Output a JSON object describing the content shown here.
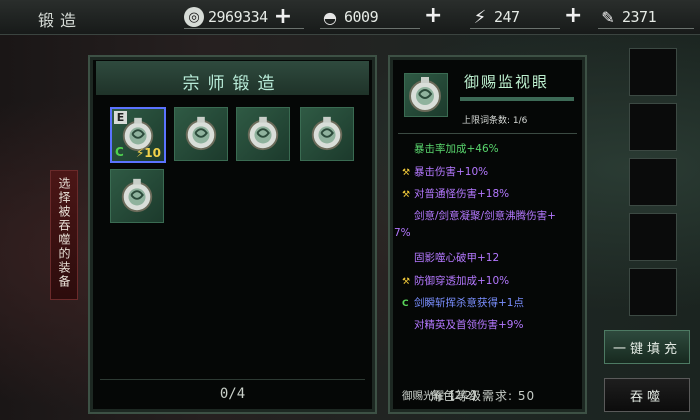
{
  "header": {
    "title": "锻造",
    "resources": [
      {
        "icon": "coin-icon",
        "value": "2969334"
      },
      {
        "icon": "silver-ingot-icon",
        "value": "6009"
      },
      {
        "icon": "lightning-icon",
        "value": "247"
      },
      {
        "icon": "ticket-icon",
        "value": "2371"
      }
    ]
  },
  "forge_panel": {
    "title": "宗师锻造",
    "slots": [
      {
        "badge": "E",
        "level": "10",
        "selected": true
      },
      {
        "badge": "",
        "level": "",
        "selected": false
      },
      {
        "badge": "",
        "level": "",
        "selected": false
      },
      {
        "badge": "",
        "level": "",
        "selected": false
      },
      {
        "badge": "",
        "level": "",
        "selected": false
      }
    ],
    "count": "0/4"
  },
  "side_banner": {
    "text": "选择被吞噬的装备"
  },
  "item_detail": {
    "name": "御赐监视眼",
    "limit_text": "上限词条数: 1/6",
    "stats": [
      {
        "text": "暴击率加成+46%",
        "color": "green",
        "marker": ""
      },
      {
        "text": "暴击伤害+10%",
        "color": "purple",
        "marker": "upgrade-icon"
      },
      {
        "text": "对普通怪伤害+18%",
        "color": "purple",
        "marker": "upgrade-icon"
      },
      {
        "text": "剑意/剑意凝聚/剑意沸腾伤害+",
        "color": "purple",
        "marker": ""
      },
      {
        "text": "7%",
        "color": "purple",
        "marker": ""
      },
      {
        "text": "固影噬心破甲+12",
        "color": "purple",
        "marker": ""
      },
      {
        "text": "防御穿透加成+10%",
        "color": "purple",
        "marker": "upgrade-icon"
      },
      {
        "text": "剑瞬斩挥杀意获得+1点",
        "color": "blue",
        "marker": "refresh-icon"
      },
      {
        "text": "对精英及首领伤害+9%",
        "color": "purple",
        "marker": ""
      }
    ],
    "set_bonus": "御赐光耀【2/2】",
    "requirement": "角色等级需求: 50"
  },
  "buttons": {
    "auto_fill": "一键填充",
    "devour": "吞噬"
  }
}
